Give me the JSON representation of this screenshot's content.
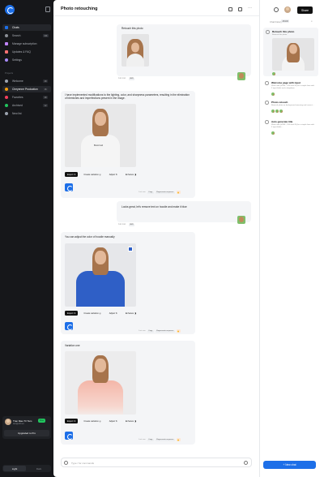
{
  "sidebar": {
    "nav": [
      {
        "label": "Chats",
        "color": "#1d6fe8"
      },
      {
        "label": "Search",
        "color": "#8b8f96",
        "kbd": "⌘K"
      },
      {
        "label": "Manage subscription",
        "color": "#c084fc"
      },
      {
        "label": "Updates & FAQ",
        "color": "#f87171"
      },
      {
        "label": "Settings",
        "color": "#a78bfa"
      }
    ],
    "section": "Projects",
    "projects": [
      {
        "label": "Welcome",
        "color": "#9ca3af",
        "count": "48"
      },
      {
        "label": "Cheyenne Production",
        "color": "#f59e0b",
        "count": "16"
      },
      {
        "label": "Favorites",
        "color": "#f43f5e",
        "count": "28"
      },
      {
        "label": "Archived",
        "color": "#22c55e",
        "count": "12"
      },
      {
        "label": "New list",
        "color": "#9ca3af"
      }
    ],
    "user": {
      "name": "Tran Mau Tri Tam",
      "email": "tam@ui8.net",
      "plan": "Free"
    },
    "upgrade": "Upgraded to Pro",
    "theme": {
      "light": "Light",
      "dark": "Dark"
    }
  },
  "header": {
    "title": "Photo retouching"
  },
  "messages": {
    "m1": {
      "text": "Retouch this photo",
      "time": "Just now",
      "edit": "Edit"
    },
    "b1": {
      "text": "I have implemented modifications to the lighting, color, and sharpness parameters, resulting in the elimination of blemishes and imperfections present in the image.",
      "shirt": "Brand Lab"
    },
    "m2": {
      "text": "Looks great, let's remove text on hoodie and make it blue",
      "time": "Just now",
      "edit": "Edit"
    },
    "b2": {
      "text": "You can adjust the color of hoodie manually"
    },
    "b3": {
      "text": "Variation one"
    }
  },
  "actions": {
    "export": "Export",
    "variation": "Create variation",
    "adjust": "Adjust",
    "enhance": "Enhance"
  },
  "meta": {
    "time": "Just now",
    "copy": "Copy",
    "regen": "Regenerate response"
  },
  "input": {
    "placeholder": "Type / for commands"
  },
  "right": {
    "share": "Share",
    "label": "Chat history",
    "badge": "26/100",
    "items": [
      {
        "title": "Retouch this photo",
        "desc": "Retouch this photo"
      },
      {
        "title": "Welcome page with input",
        "desc": "Write code (HTML, CSS and JS) for a simple form with 3 input fields and a dropdown"
      },
      {
        "title": "Photo retouch",
        "desc": "Retouch photo on background removing and correct…"
      },
      {
        "title": "Auto generate title",
        "desc": "Write code (HTML, CSS and JS) for a simple form with 3 input fields…"
      }
    ],
    "newchat": "New chat"
  },
  "colors": {
    "accent": "#1d6fe8",
    "sidebar": "#16171a",
    "hoodie_blue": "#2f5fc6",
    "hoodie_pink": "#f4b6a8"
  }
}
